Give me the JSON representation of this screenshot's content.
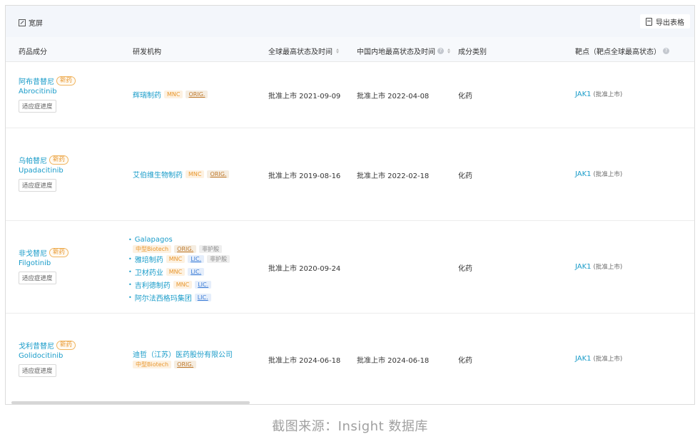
{
  "toolbar": {
    "wide_label": "宽屏",
    "export_label": "导出表格"
  },
  "columns": {
    "drug": "药品成分",
    "org": "研发机构",
    "global": "全球最高状态及时间",
    "china": "中国内地最高状态及时间",
    "type": "成分类别",
    "target": "靶点（靶点全球最高状态）"
  },
  "rows": [
    {
      "cn": "阿布昔替尼",
      "new_tag": "新药",
      "en": "Abrocitinib",
      "ind_btn": "适应症进度",
      "orgs": [
        {
          "name": "辉瑞制药",
          "tags": [
            "MNC",
            "ORIG."
          ]
        }
      ],
      "global": "批准上市 2021-09-09",
      "china": "批准上市 2022-04-08",
      "type": "化药",
      "target": "JAK1",
      "target_status": "(批准上市)"
    },
    {
      "cn": "乌帕替尼",
      "new_tag": "新药",
      "en": "Upadacitinib",
      "ind_btn": "适应症进度",
      "orgs": [
        {
          "name": "艾伯维生物制药",
          "tags": [
            "MNC",
            "ORIG."
          ]
        }
      ],
      "global": "批准上市 2019-08-16",
      "china": "批准上市 2022-02-18",
      "type": "化药",
      "target": "JAK1",
      "target_status": "(批准上市)"
    },
    {
      "cn": "非戈替尼",
      "new_tag": "新药",
      "en": "Filgotinib",
      "ind_btn": "适应症进度",
      "orgs": [
        {
          "name": "Galapagos",
          "tags": [
            "中型Biotech",
            "ORIG.",
            "非护股"
          ]
        },
        {
          "name": "雅培制药",
          "tags": [
            "MNC",
            "LIC.",
            "非护股"
          ]
        },
        {
          "name": "卫材药业",
          "tags": [
            "MNC",
            "LIC."
          ]
        },
        {
          "name": "吉利德制药",
          "tags": [
            "MNC",
            "LIC."
          ]
        },
        {
          "name": "阿尔法西格玛集团",
          "tags": [
            "LIC."
          ]
        }
      ],
      "global": "批准上市 2020-09-24",
      "china": "",
      "type": "化药",
      "target": "JAK1",
      "target_status": "(批准上市)"
    },
    {
      "cn": "戈利昔替尼",
      "new_tag": "新药",
      "en": "Golidocitinib",
      "ind_btn": "适应症进度",
      "orgs": [
        {
          "name": "迪哲（江苏）医药股份有限公司",
          "tags": [
            "中型Biotech",
            "ORIG."
          ]
        }
      ],
      "global": "批准上市 2024-06-18",
      "china": "批准上市 2024-06-18",
      "type": "化药",
      "target": "JAK1",
      "target_status": "(批准上市)"
    }
  ],
  "caption": "截图来源：Insight 数据库"
}
